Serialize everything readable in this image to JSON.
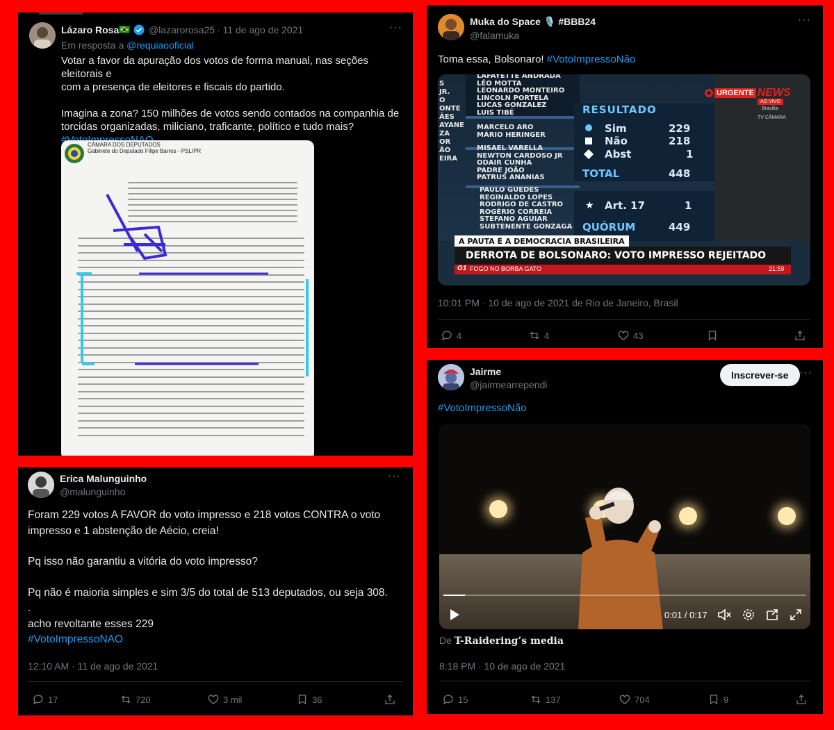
{
  "tweet1": {
    "name": "Lázaro Rosa",
    "flag": "🇧🇷",
    "handle": "@lazarorosa25",
    "date": "· 11 de ago de 2021",
    "reply_prefix": "Em resposta a",
    "reply_handle": "@requiaooficial",
    "line1": "Votar a favor da apuração dos votos de forma manual, nas seções eleitorais e",
    "line2": "com a presença de eleitores e fiscais do partido.",
    "line3": "Imagina a zona? 150 milhões de votos sendo contados na companhia de",
    "line4": "torcidas organizadas, miliciano, traficante, político e tudo mais?",
    "hashtag": "#VotoImpressoNAO",
    "doc_header1": "CÂMARA DOS DEPUTADOS",
    "doc_header2": "Gabinete do Deputado Filipe Barros - PSL/PR"
  },
  "tweet2": {
    "name": "Muka do Space",
    "name_suffix": "🎙️ #BBB24",
    "handle": "@falamuka",
    "text": "Toma essa, Bolsonaro!",
    "hashtag": "#VotoImpressoNão",
    "meta": "10:01 PM · 10 de ago de 2021 de Rio de Janeiro, Brasil",
    "replies": "4",
    "reposts": "4",
    "likes": "43",
    "tv": {
      "names_top": [
        "LAFAYETTE ANDRADA",
        "LÉO MOTTA",
        "LEONARDO MONTEIRO",
        "LINCOLN PORTELA",
        "LUCAS GONZALEZ",
        "LUIS TIBÉ"
      ],
      "names_mid": [
        "MARCELO ARO",
        "MÁRIO HERINGER"
      ],
      "names_low": [
        "MISAEL VARELLA",
        "NEWTON CARDOSO JR",
        "ODAIR CUNHA",
        "PADRE JOÃO",
        "PATRUS ANANIAS"
      ],
      "names_bottom": [
        "PAULO GUEDES",
        "REGINALDO LOPES",
        "RODRIGO DE CASTRO",
        "ROGÉRIO CORREIA",
        "STEFANO AGUIAR",
        "SUBTENENTE GONZAGA"
      ],
      "left_labels": [
        "S",
        "JR.",
        "O",
        "ONTE",
        "ÃES",
        "AYANE",
        "ZA",
        "OR",
        "ÃO",
        "EIRA"
      ],
      "result_title": "RESULTADO",
      "sim_label": "Sim",
      "sim_value": "229",
      "nao_label": "Não",
      "nao_value": "218",
      "abst_label": "Abst",
      "abst_value": "1",
      "total_label": "TOTAL",
      "total_value": "448",
      "art_label": "Art. 17",
      "art_value": "1",
      "quorum_label": "QUÓRUM",
      "quorum_value": "449",
      "urgente": "URGENTE",
      "news": "NEWS",
      "ao_vivo": "AO VIVO",
      "brasilia": "Brasília",
      "tv_camara": "TV CÂMARA",
      "pauta": "A PAUTA É A DEMOCRACIA BRASILEIRA",
      "headline": "DERROTA DE BOLSONARO: VOTO IMPRESSO REJEITADO",
      "g1": "G1",
      "ticker": "FOGO NO BORBA GATO",
      "clock": "21:59"
    }
  },
  "tweet3": {
    "name": "Erica Malunguinho",
    "handle": "@malunguinho",
    "line1": "Foram 229 votos A FAVOR do voto impresso e 218 votos CONTRA o voto",
    "line2": "impresso e 1 abstenção de Aécio, creia!",
    "line3": "Pq isso não garantiu a vitória do voto impresso?",
    "line4": "Pq não é maioria simples e sim 3/5 do total de 513 deputados, ou seja 308.",
    "line5": ".",
    "line6": "acho revoltante esses 229",
    "hashtag": "#VotoImpressoNAO",
    "meta": "12:10 AM · 11 de ago de 2021",
    "replies": "17",
    "reposts": "720",
    "likes": "3 mil",
    "bookmarks": "36"
  },
  "tweet4": {
    "name": "Jairme",
    "handle": "@jairmearrependi",
    "subscribe": "Inscrever-se",
    "hashtag": "#VotoImpressoNão",
    "video_time": "0:01 / 0:17",
    "progress": 0.06,
    "media_prefix": "De",
    "media_source": "T-Raidering’s media",
    "meta": "8:18 PM · 10 de ago de 2021",
    "replies": "15",
    "reposts": "137",
    "likes": "704",
    "bookmarks": "9"
  }
}
